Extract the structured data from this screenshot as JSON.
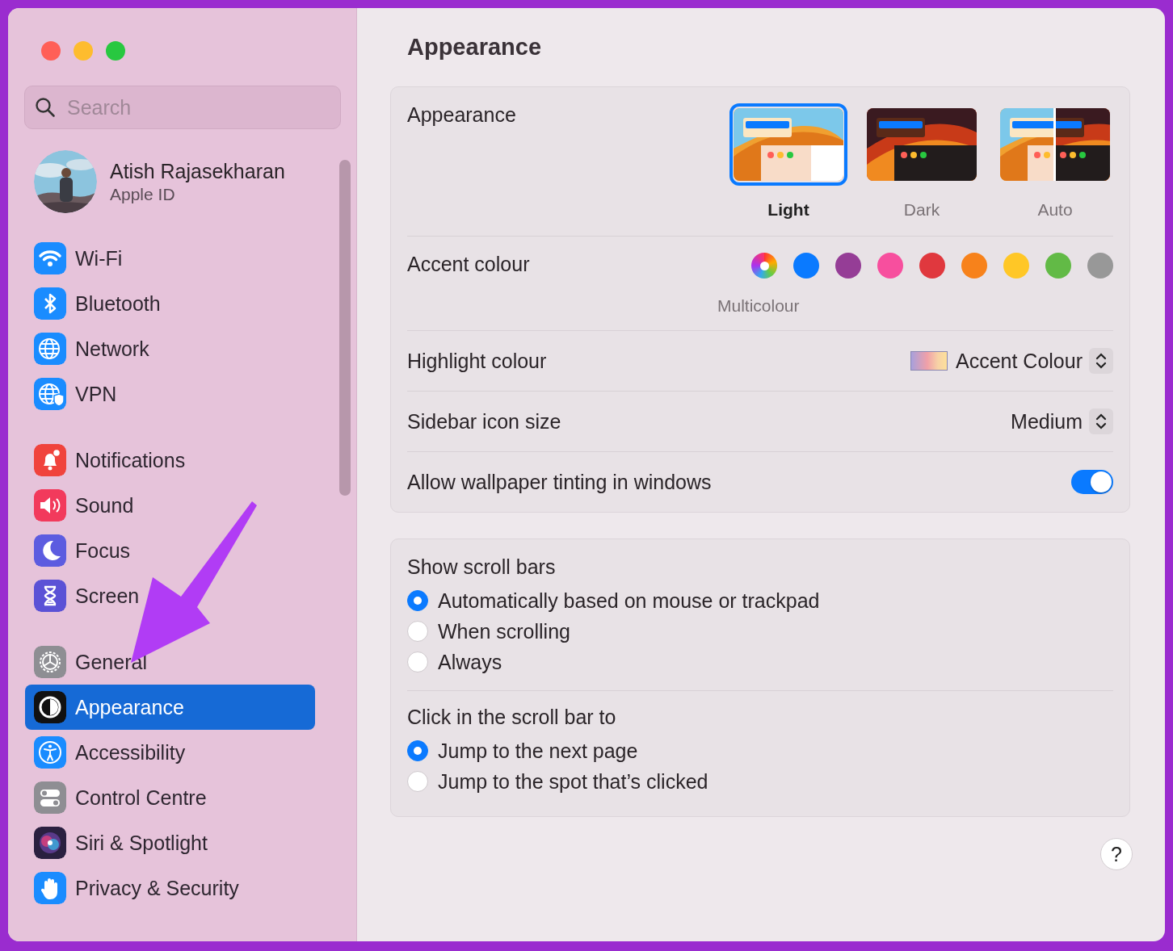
{
  "window": {
    "controls": [
      {
        "kind": "close"
      },
      {
        "kind": "minimize"
      },
      {
        "kind": "zoom"
      }
    ]
  },
  "sidebar": {
    "search": {
      "placeholder": "Search"
    },
    "account": {
      "name": "Atish Rajasekharan",
      "subtitle": "Apple ID"
    },
    "groups": [
      [
        {
          "label": "Wi-Fi",
          "kind": "wifi",
          "selected": false
        },
        {
          "label": "Bluetooth",
          "kind": "bluetooth",
          "selected": false
        },
        {
          "label": "Network",
          "kind": "network",
          "selected": false
        },
        {
          "label": "VPN",
          "kind": "vpn",
          "selected": false
        }
      ],
      [
        {
          "label": "Notifications",
          "kind": "notifications",
          "selected": false
        },
        {
          "label": "Sound",
          "kind": "sound",
          "selected": false
        },
        {
          "label": "Focus",
          "kind": "focus",
          "selected": false
        },
        {
          "label": "Screen",
          "kind": "screen-time",
          "selected": false
        }
      ],
      [
        {
          "label": "General",
          "kind": "general",
          "selected": false
        },
        {
          "label": "Appearance",
          "kind": "appearance",
          "selected": true
        },
        {
          "label": "Accessibility",
          "kind": "accessibility",
          "selected": false
        },
        {
          "label": "Control Centre",
          "kind": "control-centre",
          "selected": false
        },
        {
          "label": "Siri & Spotlight",
          "kind": "siri",
          "selected": false
        },
        {
          "label": "Privacy & Security",
          "kind": "privacy",
          "selected": false
        }
      ]
    ]
  },
  "main": {
    "title": "Appearance",
    "appearance": {
      "label": "Appearance",
      "options": [
        {
          "label": "Light",
          "kind": "light",
          "selected": true
        },
        {
          "label": "Dark",
          "kind": "dark",
          "selected": false
        },
        {
          "label": "Auto",
          "kind": "auto",
          "selected": false
        }
      ]
    },
    "accent": {
      "label": "Accent colour",
      "colors": [
        {
          "kind": "multi",
          "label": "Multicolour",
          "selected": true
        },
        {
          "kind": "solid",
          "color": "#0a7aff",
          "selected": false
        },
        {
          "kind": "solid",
          "color": "#953d96",
          "selected": false
        },
        {
          "kind": "solid",
          "color": "#f74f9e",
          "selected": false
        },
        {
          "kind": "solid",
          "color": "#e0383e",
          "selected": false
        },
        {
          "kind": "solid",
          "color": "#f7821b",
          "selected": false
        },
        {
          "kind": "solid",
          "color": "#ffc726",
          "selected": false
        },
        {
          "kind": "solid",
          "color": "#62ba46",
          "selected": false
        },
        {
          "kind": "solid",
          "color": "#989898",
          "selected": false
        }
      ]
    },
    "highlight": {
      "label": "Highlight colour",
      "value": "Accent Colour"
    },
    "icon_size": {
      "label": "Sidebar icon size",
      "value": "Medium"
    },
    "tinting": {
      "label": "Allow wallpaper tinting in windows",
      "on": true
    },
    "scroll_groups": [
      {
        "title": "Show scroll bars",
        "options": [
          {
            "label": "Automatically based on mouse or trackpad",
            "selected": true
          },
          {
            "label": "When scrolling",
            "selected": false
          },
          {
            "label": "Always",
            "selected": false
          }
        ]
      },
      {
        "title": "Click in the scroll bar to",
        "options": [
          {
            "label": "Jump to the next page",
            "selected": true
          },
          {
            "label": "Jump to the spot that’s clicked",
            "selected": false
          }
        ]
      }
    ],
    "help_button": "?"
  }
}
